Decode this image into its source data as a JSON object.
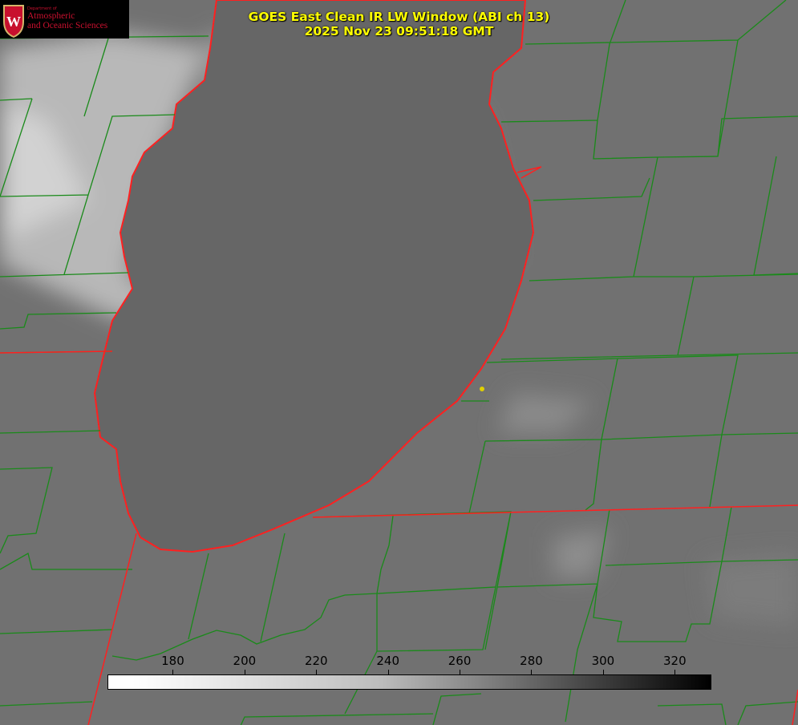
{
  "title": {
    "line1": "GOES East Clean IR LW Window (ABI ch 13)",
    "line2": "2025 Nov 23 09:51:18 GMT"
  },
  "logo": {
    "dept": "Department of",
    "line1": "Atmospheric",
    "line2": "and Oceanic Sciences"
  },
  "colorbar": {
    "ticks": [
      "180",
      "200",
      "220",
      "240",
      "260",
      "280",
      "300",
      "320"
    ],
    "min": 162,
    "max": 330,
    "units_colormap": "white-to-black brightness temperature (K)"
  },
  "colors": {
    "county_lines": "#1a8a1a",
    "state_lines": "#ff2020",
    "title": "#ffff00",
    "marker": "#e0d000"
  }
}
